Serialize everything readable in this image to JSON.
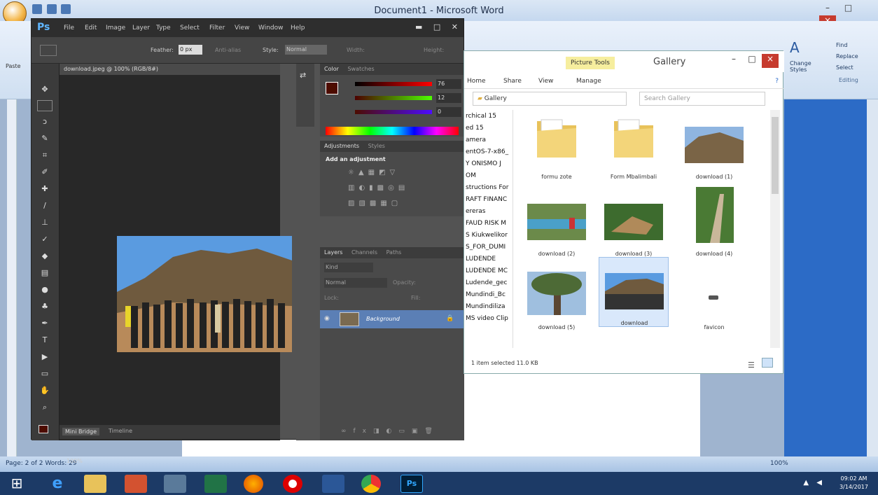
{
  "word": {
    "title": "Document1 - Microsoft Word",
    "paste_label": "Paste",
    "ribbon_right": {
      "change_styles": "Change Styles",
      "find": "Find",
      "replace": "Replace",
      "select": "Select",
      "editing": "Editing"
    },
    "status": {
      "page": "Page: 2 of 2",
      "words": "Words: 29",
      "zoom": "100%"
    }
  },
  "photoshop": {
    "logo": "Ps",
    "menus": [
      "File",
      "Edit",
      "Image",
      "Layer",
      "Type",
      "Select",
      "Filter",
      "View",
      "Window",
      "Help"
    ],
    "options": {
      "feather_label": "Feather:",
      "feather_value": "0 px",
      "antialias_label": "Anti-alias",
      "style_label": "Style:",
      "style_value": "Normal",
      "width_label": "Width:",
      "height_label": "Height:"
    },
    "doc_tab": "download.jpeg @ 100% (RGB/8#)",
    "zoom": "100%",
    "bottom_tabs": [
      "Mini Bridge",
      "Timeline"
    ],
    "panels": {
      "color_tabs": [
        "Color",
        "Swatches"
      ],
      "color_values": {
        "r": "76",
        "g": "12",
        "b": "0"
      },
      "adjust_tabs": [
        "Adjustments",
        "Styles"
      ],
      "add_adjustment": "Add an adjustment",
      "layers_tabs": [
        "Layers",
        "Channels",
        "Paths"
      ],
      "kind_label": "Kind",
      "blend_mode": "Normal",
      "opacity_label": "Opacity:",
      "lock_label": "Lock:",
      "fill_label": "Fill:",
      "layer_name": "Background"
    }
  },
  "explorer": {
    "title": "Gallery",
    "picture_tools": "Picture Tools",
    "ribbon_tabs": [
      "Home",
      "Share",
      "View",
      "Manage"
    ],
    "address": "Gallery",
    "search_placeholder": "Search Gallery",
    "nav_items": [
      "rchical 15",
      "ed 15",
      "amera",
      "entOS-7-x86_",
      "Y ONISMO J",
      "OM",
      "structions For",
      "RAFT FINANC",
      "ereras",
      "FAUD RISK M",
      "S Kiukwelikor",
      "S_FOR_DUMI",
      "LUDENDE",
      "LUDENDE MC",
      "Ludende_gec",
      "Mundindi_Bc",
      "Mundindiliza",
      "MS video Clip"
    ],
    "files": [
      {
        "name": "formu zote",
        "kind": "folder"
      },
      {
        "name": "Form Mbalimbali",
        "kind": "folder"
      },
      {
        "name": "download (1)",
        "kind": "image"
      },
      {
        "name": "download (2)",
        "kind": "image"
      },
      {
        "name": "download (3)",
        "kind": "image"
      },
      {
        "name": "download (4)",
        "kind": "image"
      },
      {
        "name": "download (5)",
        "kind": "image"
      },
      {
        "name": "download",
        "kind": "image"
      },
      {
        "name": "favicon",
        "kind": "icon"
      }
    ],
    "status": "1 item selected  11.0 KB"
  },
  "taskbar": {
    "clock_time": "09:02 AM",
    "clock_date": "3/14/2017",
    "ps_label": "Ps"
  }
}
